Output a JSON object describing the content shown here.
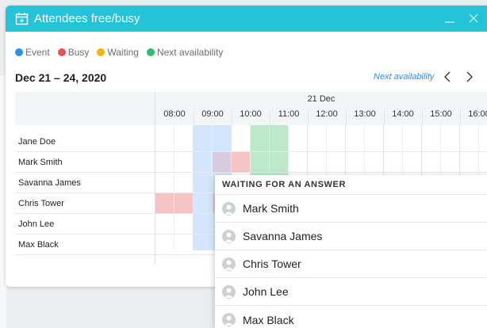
{
  "window": {
    "title": "Attendees free/busy"
  },
  "legend": [
    {
      "label": "Event",
      "color": "#2d8fe8"
    },
    {
      "label": "Busy",
      "color": "#e55353"
    },
    {
      "label": "Waiting",
      "color": "#f2b705"
    },
    {
      "label": "Next availability",
      "color": "#2bbf6a"
    }
  ],
  "header": {
    "date_range": "Dec 21 – 24, 2020",
    "next_availability": "Next availability"
  },
  "grid": {
    "day": "21 Dec",
    "hours": [
      "08:00",
      "09:00",
      "10:00",
      "11:00",
      "12:00",
      "13:00",
      "14:00",
      "15:00",
      "16:00"
    ],
    "attendees": [
      "Jane Doe",
      "Mark Smith",
      "Savanna James",
      "Chris Tower",
      "John Lee",
      "Max Black"
    ]
  },
  "popup": {
    "title": "WAITING FOR AN ANSWER",
    "items": [
      "Mark Smith",
      "Savanna James",
      "Chris Tower",
      "John Lee",
      "Max Black"
    ]
  },
  "colors": {
    "accent": "#25c3d8",
    "event": "#d4e6fb",
    "busy": "#f5c4c4",
    "available": "#bde9cb",
    "waiting": "#d6cde0"
  }
}
